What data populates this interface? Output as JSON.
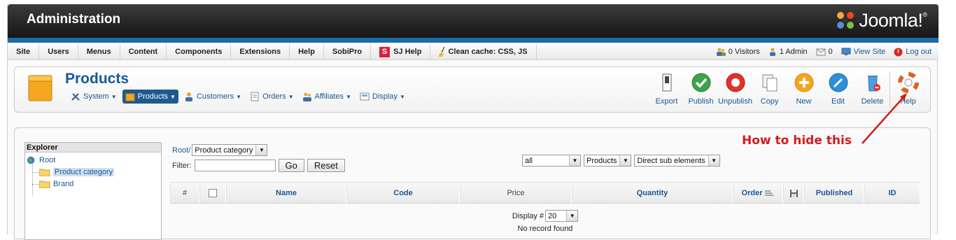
{
  "header": {
    "title": "Administration",
    "brand": "Joomla!",
    "brand_mark": "®"
  },
  "menubar": {
    "items": [
      "Site",
      "Users",
      "Menus",
      "Content",
      "Components",
      "Extensions",
      "Help",
      "SobiPro",
      "SJ Help",
      "Clean cache: CSS, JS"
    ],
    "sj_badge": "S",
    "status": {
      "visitors": "0 Visitors",
      "admins": "1 Admin",
      "messages": "0",
      "view_site": "View Site",
      "logout": "Log out"
    }
  },
  "toolbar": {
    "page_title": "Products",
    "submenu": [
      "System",
      "Products",
      "Customers",
      "Orders",
      "Affiliates",
      "Display"
    ],
    "active_submenu": "Products",
    "tools": [
      "Export",
      "Publish",
      "Unpublish",
      "Copy",
      "New",
      "Edit",
      "Delete",
      "Help"
    ]
  },
  "explorer": {
    "heading": "Explorer",
    "root": "Root",
    "nodes": [
      "Product category",
      "Brand"
    ],
    "selected": "Product category"
  },
  "filters": {
    "crumb_root": "Root/",
    "crumb_select": "Product category",
    "filter_label": "Filter:",
    "filter_value": "",
    "go_label": "Go",
    "reset_label": "Reset",
    "select_all": "all",
    "select_type": "Products",
    "select_scope": "Direct sub elements"
  },
  "table": {
    "columns": [
      "#",
      "",
      "Name",
      "Code",
      "Price",
      "Quantity",
      "Order",
      "",
      "Published",
      "ID"
    ],
    "display_label": "Display #",
    "display_value": "20",
    "empty_text": "No record found"
  },
  "annotation": {
    "text": "How to hide this"
  },
  "colors": {
    "accent": "#1a6ca8",
    "link": "#1b5792",
    "annotation": "#d21c1c"
  }
}
